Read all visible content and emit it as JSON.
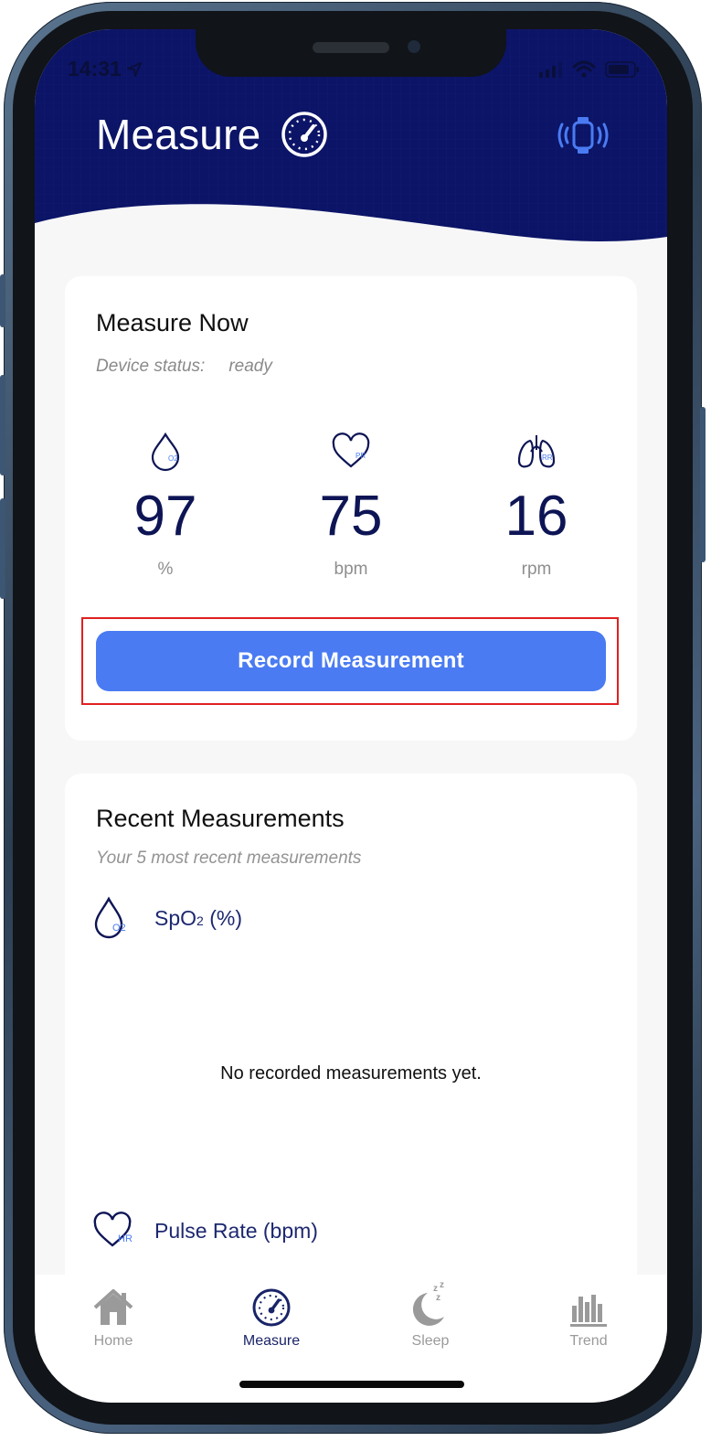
{
  "status_bar": {
    "time": "14:31"
  },
  "header": {
    "title": "Measure"
  },
  "measure_now": {
    "title": "Measure Now",
    "device_status_label": "Device status:",
    "device_status_value": "ready",
    "metrics": [
      {
        "icon": "droplet-o2-icon",
        "icon_text": "O2",
        "value": "97",
        "unit": "%"
      },
      {
        "icon": "heart-pr-icon",
        "icon_text": "PR",
        "value": "75",
        "unit": "bpm"
      },
      {
        "icon": "lungs-rr-icon",
        "icon_text": "RR",
        "value": "16",
        "unit": "rpm"
      }
    ],
    "record_button": "Record Measurement"
  },
  "recent": {
    "title": "Recent Measurements",
    "subtitle": "Your 5 most recent measurements",
    "spo2_label_main": "SpO",
    "spo2_label_sub": "2",
    "spo2_label_unit": " (%)",
    "spo2_icon_text": "O2",
    "empty_message": "No recorded measurements yet.",
    "pulse_label": "Pulse Rate (bpm)",
    "pulse_icon_text": "HR"
  },
  "tabs": [
    {
      "label": "Home",
      "icon": "home-icon",
      "active": false
    },
    {
      "label": "Measure",
      "icon": "gauge-icon",
      "active": true
    },
    {
      "label": "Sleep",
      "icon": "moon-sleep-icon",
      "active": false
    },
    {
      "label": "Trend",
      "icon": "bar-chart-icon",
      "active": false
    }
  ],
  "colors": {
    "header_bg": "#0b1466",
    "accent": "#4a7bf2",
    "metric_value": "#0e1555",
    "highlight": "#e02020"
  }
}
